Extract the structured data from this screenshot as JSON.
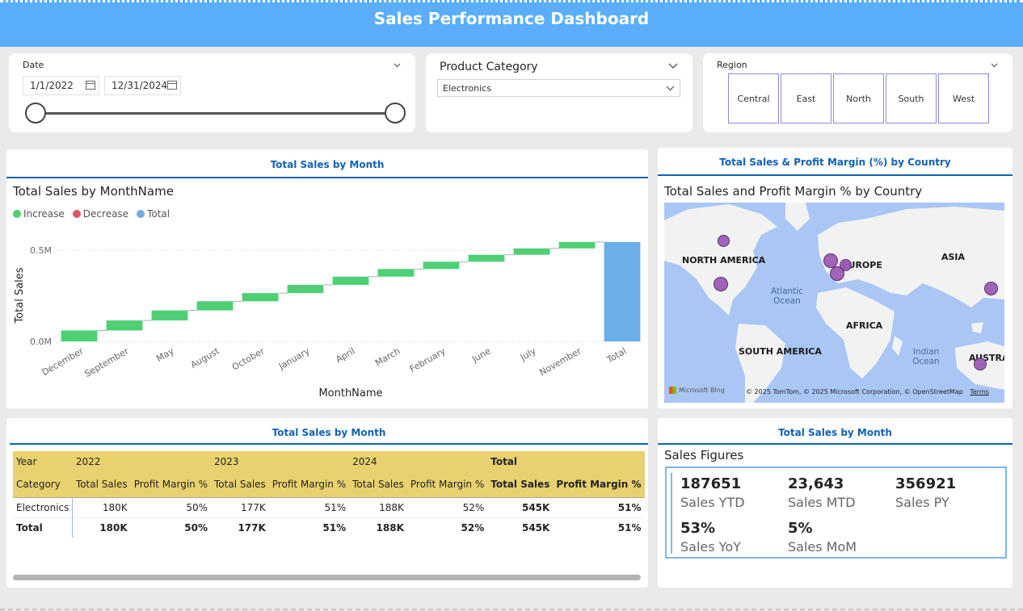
{
  "header": {
    "title": "Sales Performance Dashboard"
  },
  "date_slicer": {
    "title": "Date",
    "start": "1/1/2022",
    "end": "12/31/2024"
  },
  "category_slicer": {
    "title": "Product Category",
    "selected": "Electronics"
  },
  "region_slicer": {
    "title": "Region",
    "options": [
      "Central",
      "East",
      "North",
      "South",
      "West"
    ]
  },
  "waterfall": {
    "header": "Total Sales by Month",
    "title": "Total Sales by MonthName",
    "legend": [
      "Increase",
      "Decrease",
      "Total"
    ],
    "xlabel": "MonthName",
    "ylabel": "Total Sales",
    "colors": {
      "increase": "#4fcf74",
      "decrease": "#e6536b",
      "total": "#6aaeea"
    }
  },
  "chart_data": {
    "type": "bar",
    "subtype": "waterfall",
    "title": "Total Sales by MonthName",
    "xlabel": "MonthName",
    "ylabel": "Total Sales",
    "ytick_labels": [
      "0.0M",
      "0.5M"
    ],
    "yticks": [
      0,
      500000
    ],
    "categories": [
      "December",
      "September",
      "May",
      "August",
      "October",
      "January",
      "April",
      "March",
      "February",
      "June",
      "July",
      "November",
      "Total"
    ],
    "values": [
      60000,
      55000,
      55000,
      50000,
      45000,
      45000,
      45000,
      42000,
      40000,
      38000,
      35000,
      35000,
      545000
    ],
    "kinds": [
      "increase",
      "increase",
      "increase",
      "increase",
      "increase",
      "increase",
      "increase",
      "increase",
      "increase",
      "increase",
      "increase",
      "increase",
      "total"
    ],
    "ylim": [
      0,
      545000
    ],
    "grid": true,
    "legend_position": "top-left"
  },
  "map_visual": {
    "header": "Total Sales & Profit Margin (%) by Country",
    "title": "Total Sales and Profit Margin % by Country",
    "labels": [
      "NORTH AMERICA",
      "EUROPE",
      "ASIA",
      "AFRICA",
      "SOUTH AMERICA",
      "AUSTRA"
    ],
    "oceans": [
      "Atlantic Ocean",
      "Indian Ocean"
    ],
    "attribution": "© 2025 TomTom, © 2025 Microsoft Corporation, © OpenStreetMap",
    "terms": "Terms",
    "logo": "Microsoft Bing"
  },
  "matrix": {
    "header": "Total Sales by Month",
    "row_year": "Year",
    "row_category": "Category",
    "years": [
      "2022",
      "2023",
      "2024"
    ],
    "total_label": "Total",
    "col_sales": "Total Sales",
    "col_margin": "Profit Margin %",
    "rows": [
      {
        "label": "Electronics",
        "cells": [
          "180K",
          "50%",
          "177K",
          "51%",
          "188K",
          "52%",
          "545K",
          "51%"
        ]
      },
      {
        "label": "Total",
        "cells": [
          "180K",
          "50%",
          "177K",
          "51%",
          "188K",
          "52%",
          "545K",
          "51%"
        ]
      }
    ]
  },
  "kpi": {
    "header": "Total Sales by Month",
    "title": "Sales Figures",
    "items": [
      {
        "value": "187651",
        "label": "Sales YTD"
      },
      {
        "value": "23,643",
        "label": "Sales MTD"
      },
      {
        "value": "356921",
        "label": "Sales PY"
      },
      {
        "value": "53%",
        "label": "Sales YoY"
      },
      {
        "value": "5%",
        "label": "Sales MoM"
      }
    ]
  }
}
